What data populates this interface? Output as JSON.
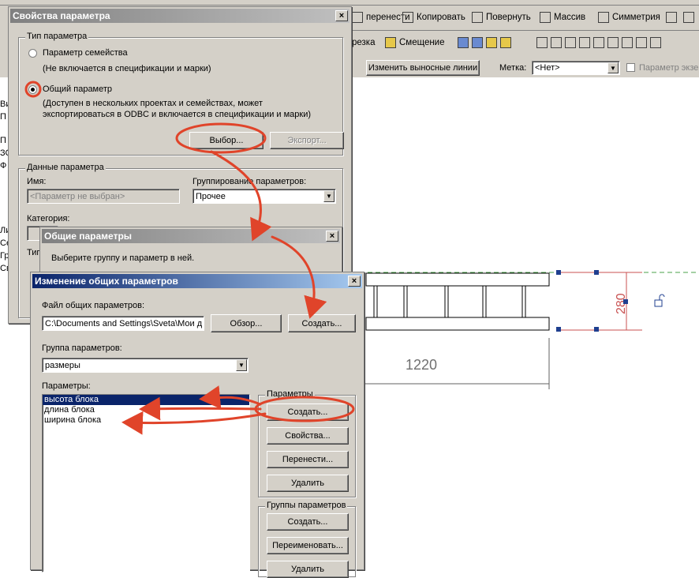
{
  "toolbar": {
    "row1": [
      "перенести",
      "Копировать",
      "Повернуть",
      "Массив",
      "Симметрия"
    ],
    "row2": [
      "резка",
      "Смещение"
    ],
    "row3": {
      "change_leaders": "Изменить выносные линии",
      "label_caption": "Метка:",
      "label_value": "<Нет>",
      "param_checkbox": "Параметр экзе"
    }
  },
  "left_panel": {
    "items": [
      "Ви",
      "П",
      "П",
      "ЗС",
      "Ф",
      "Ли",
      "Се",
      "Гр",
      "Св"
    ]
  },
  "drawing": {
    "dim_width": "1220",
    "dim_height": "280"
  },
  "props_dialog": {
    "title": "Свойства параметра",
    "param_type_group": "Тип параметра",
    "family_param": "Параметр семейства",
    "family_note": "(Не включается в спецификации и марки)",
    "shared_param": "Общий параметр",
    "shared_note_1": "(Доступен в нескольких проектах и семействах, может",
    "shared_note_2": "экспортироваться в ODBC и включается в спецификации и марки)",
    "select_btn": "Выбор...",
    "export_btn": "Экспорт...",
    "data_group": "Данные параметра",
    "name_label": "Имя:",
    "name_value": "<Параметр не выбран>",
    "grouping_label": "Группирование параметров:",
    "grouping_value": "Прочее",
    "category_label": "Категория:",
    "type_label": "Тип"
  },
  "shared_dialog": {
    "title": "Общие параметры",
    "prompt": "Выберите группу и параметр в ней."
  },
  "edit_dialog": {
    "title": "Изменение общих параметров",
    "file_label": "Файл общих параметров:",
    "file_value": "C:\\Documents and Settings\\Sveta\\Мои д",
    "browse_btn": "Обзор...",
    "create_file_btn": "Создать...",
    "group_label": "Группа параметров:",
    "group_value": "размеры",
    "params_label": "Параметры:",
    "params": [
      "высота блока",
      "длина блока",
      "ширина блока"
    ],
    "params_group": "Параметры",
    "p_create": "Создать...",
    "p_props": "Свойства...",
    "p_move": "Перенести...",
    "p_delete": "Удалить",
    "groups_group": "Группы параметров",
    "g_create": "Создать...",
    "g_rename": "Переименовать...",
    "g_delete": "Удалить"
  },
  "colors": {
    "annotation": "#e0442a",
    "title_active": "#0a246a",
    "dimension": "#c85050",
    "grip": "#1f3f8f"
  }
}
